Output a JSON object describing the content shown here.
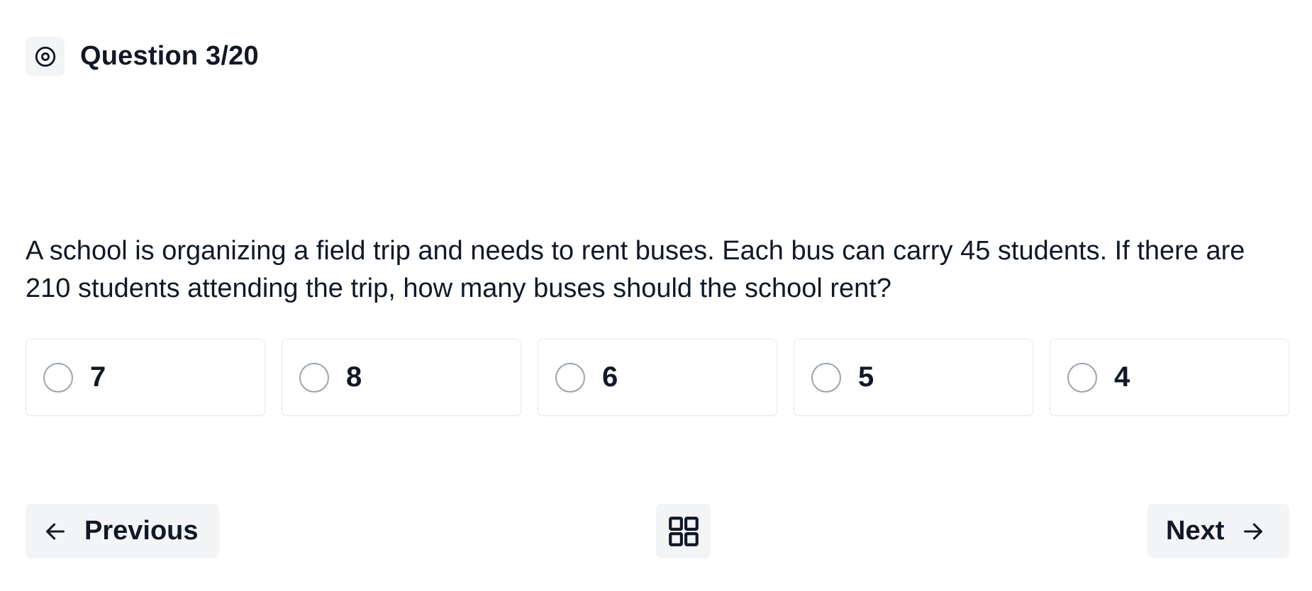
{
  "header": {
    "icon": "target-icon",
    "title": "Question 3/20"
  },
  "question": {
    "text": "A school is organizing a field trip and needs to rent buses. Each bus can carry 45 students. If there are 210 students attending the trip, how many buses should the school rent?"
  },
  "options": [
    {
      "label": "7",
      "selected": false
    },
    {
      "label": "8",
      "selected": false
    },
    {
      "label": "6",
      "selected": false
    },
    {
      "label": "5",
      "selected": false
    },
    {
      "label": "4",
      "selected": false
    }
  ],
  "navigation": {
    "previous_label": "Previous",
    "previous_icon": "arrow-left-icon",
    "grid_icon": "grid-icon",
    "next_label": "Next",
    "next_icon": "arrow-right-icon"
  },
  "colors": {
    "text": "#111827",
    "button_bg": "#f3f4f6",
    "border": "#e5e7eb",
    "radio_border": "#9ca3af"
  }
}
